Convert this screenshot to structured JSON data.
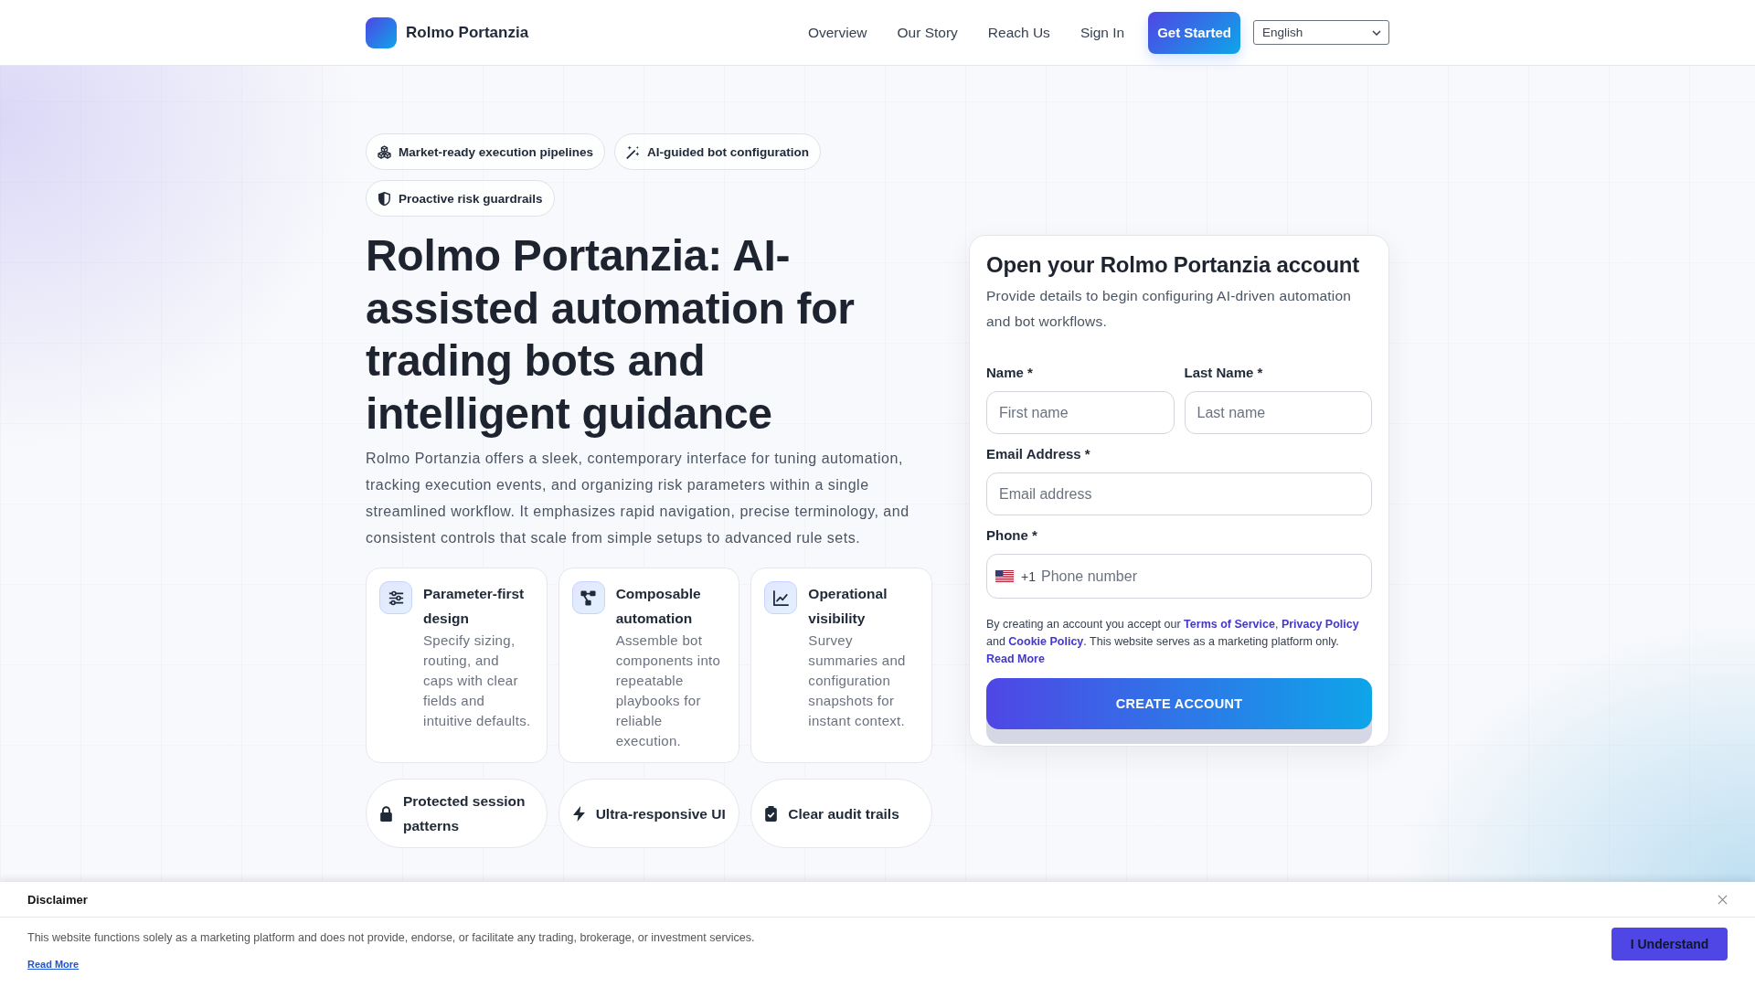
{
  "header": {
    "brand": "Rolmo Portanzia",
    "nav": [
      "Overview",
      "Our Story",
      "Reach Us",
      "Sign In"
    ],
    "cta": "Get Started",
    "language": "English"
  },
  "hero": {
    "badges": [
      "Market-ready execution pipelines",
      "AI-guided bot configuration",
      "Proactive risk guardrails"
    ],
    "title": "Rolmo Portanzia: AI-assisted automation for trading bots and intelligent guidance",
    "description": "Rolmo Portanzia offers a sleek, contemporary interface for tuning automation, tracking execution events, and organizing risk parameters within a single streamlined workflow. It emphasizes rapid navigation, precise terminology, and consistent controls that scale from simple setups to advanced rule sets.",
    "features": [
      {
        "title": "Parameter-first design",
        "text": "Specify sizing, routing, and caps with clear fields and intuitive defaults."
      },
      {
        "title": "Composable automation",
        "text": "Assemble bot components into repeatable playbooks for reliable execution."
      },
      {
        "title": "Operational visibility",
        "text": "Survey summaries and configuration snapshots for instant context."
      }
    ],
    "highlights": [
      "Protected session patterns",
      "Ultra-responsive UI",
      "Clear audit trails"
    ]
  },
  "signup": {
    "title": "Open your Rolmo Portanzia account",
    "subtitle": "Provide details to begin configuring AI-driven automation and bot workflows.",
    "rows": [
      [
        {
          "kind": "text",
          "label": "Name *",
          "placeholder": "First name"
        },
        {
          "kind": "text",
          "label": "Last Name *",
          "placeholder": "Last name"
        }
      ],
      [
        {
          "kind": "email",
          "label": "Email Address *",
          "placeholder": "Email address"
        }
      ],
      [
        {
          "kind": "phone",
          "label": "Phone *",
          "dial_code": "+1",
          "placeholder": "Phone number"
        }
      ]
    ],
    "consent": [
      {
        "kind": "text",
        "text": "By creating an account you accept our "
      },
      {
        "kind": "link",
        "text": "Terms of Service"
      },
      {
        "kind": "text",
        "text": ", "
      },
      {
        "kind": "link",
        "text": "Privacy Policy"
      },
      {
        "kind": "text",
        "text": " and "
      },
      {
        "kind": "link",
        "text": "Cookie Policy"
      },
      {
        "kind": "text",
        "text": ". This website serves as a marketing platform only."
      }
    ],
    "read_more": "Read More",
    "submit": "CREATE ACCOUNT"
  },
  "disclaimer": {
    "title": "Disclaimer",
    "text": "This website functions solely as a marketing platform and does not provide, endorse, or facilitate any trading, brokerage, or investment services.",
    "link": "Read More",
    "button": "I Understand"
  }
}
